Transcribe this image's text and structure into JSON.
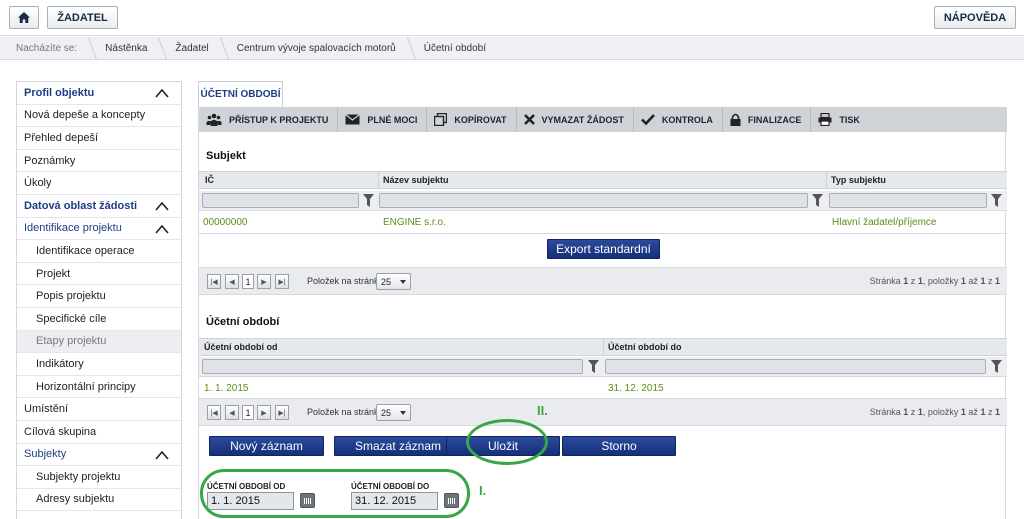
{
  "topbar": {
    "home_icon": "home-icon",
    "zadatel_label": "ŽADATEL",
    "napoveda_label": "NÁPOVĚDA"
  },
  "breadcrumb": {
    "lead": "Nacházíte se:",
    "items": [
      "Nástěnka",
      "Žadatel",
      "Centrum vývoje spalovacích motorů",
      "Účetní období"
    ]
  },
  "sidebar": {
    "items": [
      {
        "label": "Profil objektu"
      },
      {
        "label": "Nová depeše a koncepty"
      },
      {
        "label": "Přehled depeší"
      },
      {
        "label": "Poznámky"
      },
      {
        "label": "Úkoly"
      },
      {
        "label": "Datová oblast žádosti"
      },
      {
        "label": "Identifikace projektu"
      },
      {
        "label": "Identifikace operace"
      },
      {
        "label": "Projekt"
      },
      {
        "label": "Popis projektu"
      },
      {
        "label": "Specifické cíle"
      },
      {
        "label": "Etapy projektu"
      },
      {
        "label": "Indikátory"
      },
      {
        "label": "Horizontální principy"
      },
      {
        "label": "Umístění"
      },
      {
        "label": "Cílová skupina"
      },
      {
        "label": "Subjekty"
      },
      {
        "label": "Subjekty projektu"
      },
      {
        "label": "Adresy subjektu"
      }
    ]
  },
  "tab": {
    "label": "ÚČETNÍ OBDOBÍ"
  },
  "toolbar": {
    "items": [
      {
        "label": "PŘÍSTUP K PROJEKTU",
        "icon": "people-icon"
      },
      {
        "label": "PLNÉ MOCI",
        "icon": "envelope-icon"
      },
      {
        "label": "KOPÍROVAT",
        "icon": "copy-icon"
      },
      {
        "label": "VYMAZAT ŽÁDOST",
        "icon": "cross-icon"
      },
      {
        "label": "KONTROLA",
        "icon": "check-icon"
      },
      {
        "label": "FINALIZACE",
        "icon": "lock-icon"
      },
      {
        "label": "TISK",
        "icon": "printer-icon"
      }
    ]
  },
  "subjekt": {
    "title": "Subjekt",
    "columns": [
      "IČ",
      "Název subjektu",
      "Typ subjektu"
    ],
    "row": [
      "00000000",
      "ENGINE s.r.o.",
      "Hlavní žadatel/příjemce"
    ],
    "export_label": "Export standardní"
  },
  "pager": {
    "page": "1",
    "per_page_label": "Položek na stránku",
    "per_page": "25",
    "status_prefix": "Stránka",
    "status_page": "1",
    "status_of": "z",
    "status_total_pages": "1",
    "status_items": ", položky",
    "status_from": "1",
    "status_to_word": "až",
    "status_to": "1",
    "status_total_word": "z",
    "status_total": "1"
  },
  "ucetni": {
    "title": "Účetní období",
    "columns": [
      "Účetní období od",
      "Účetní období do"
    ],
    "row": [
      "1. 1. 2015",
      "31. 12. 2015"
    ]
  },
  "actions": {
    "novy": "Nový záznam",
    "smazat": "Smazat záznam",
    "ulozit": "Uložit",
    "storno": "Storno"
  },
  "form": {
    "od_label": "ÚČETNÍ OBDOBÍ OD",
    "od_value": "1. 1. 2015",
    "do_label": "ÚČETNÍ OBDOBÍ DO",
    "do_value": "31. 12. 2015"
  },
  "annotations": {
    "first": "I.",
    "second": "II.",
    "color": "#3aa646"
  }
}
